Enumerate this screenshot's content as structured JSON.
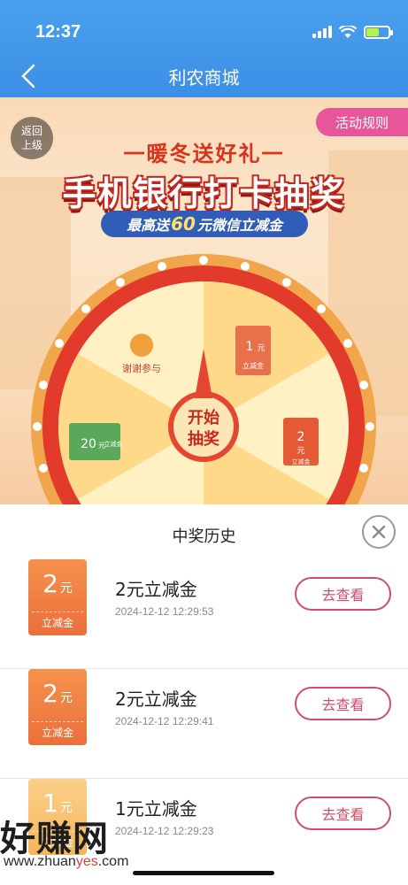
{
  "status_bar": {
    "time": "12:37"
  },
  "nav": {
    "title": "利农商城"
  },
  "banner": {
    "return_label_1": "返回",
    "return_label_2": "上级",
    "rules_label": "活动规则",
    "subtitle": "一暖冬送好礼一",
    "title": "手机银行打卡抽奖",
    "promo_prefix": "最高送",
    "promo_amount": "60",
    "promo_suffix": "元微信立减金",
    "wheel": {
      "start_line1": "开始",
      "start_line2": "抽奖",
      "prizes": [
        {
          "label": "谢谢参与"
        },
        {
          "amount": "1",
          "unit": "元",
          "label": "立减金"
        },
        {
          "amount": "2",
          "unit": "元",
          "label": "立减金"
        },
        {
          "amount": "20",
          "unit": "元",
          "label": "立减金"
        }
      ]
    }
  },
  "history": {
    "title": "中奖历史",
    "view_label": "去查看",
    "records": [
      {
        "amount": "2",
        "unit": "元",
        "coupon_label": "立减金",
        "name": "2元立减金",
        "time": "2024-12-12 12:29:53"
      },
      {
        "amount": "2",
        "unit": "元",
        "coupon_label": "立减金",
        "name": "2元立减金",
        "time": "2024-12-12 12:29:41"
      },
      {
        "amount": "1",
        "unit": "元",
        "coupon_label": "立减金",
        "name": "1元立减金",
        "time": "2024-12-12 12:29:23"
      }
    ]
  },
  "watermark": {
    "text": "好赚网",
    "url_prefix": "www.zhuan",
    "url_highlight": "yes",
    "url_suffix": ".com"
  },
  "colors": {
    "nav_blue": "#3b8fe6",
    "accent_red": "#d34d6b",
    "coupon_orange": "#eb6f3b",
    "rules_pink": "#e8569a"
  }
}
